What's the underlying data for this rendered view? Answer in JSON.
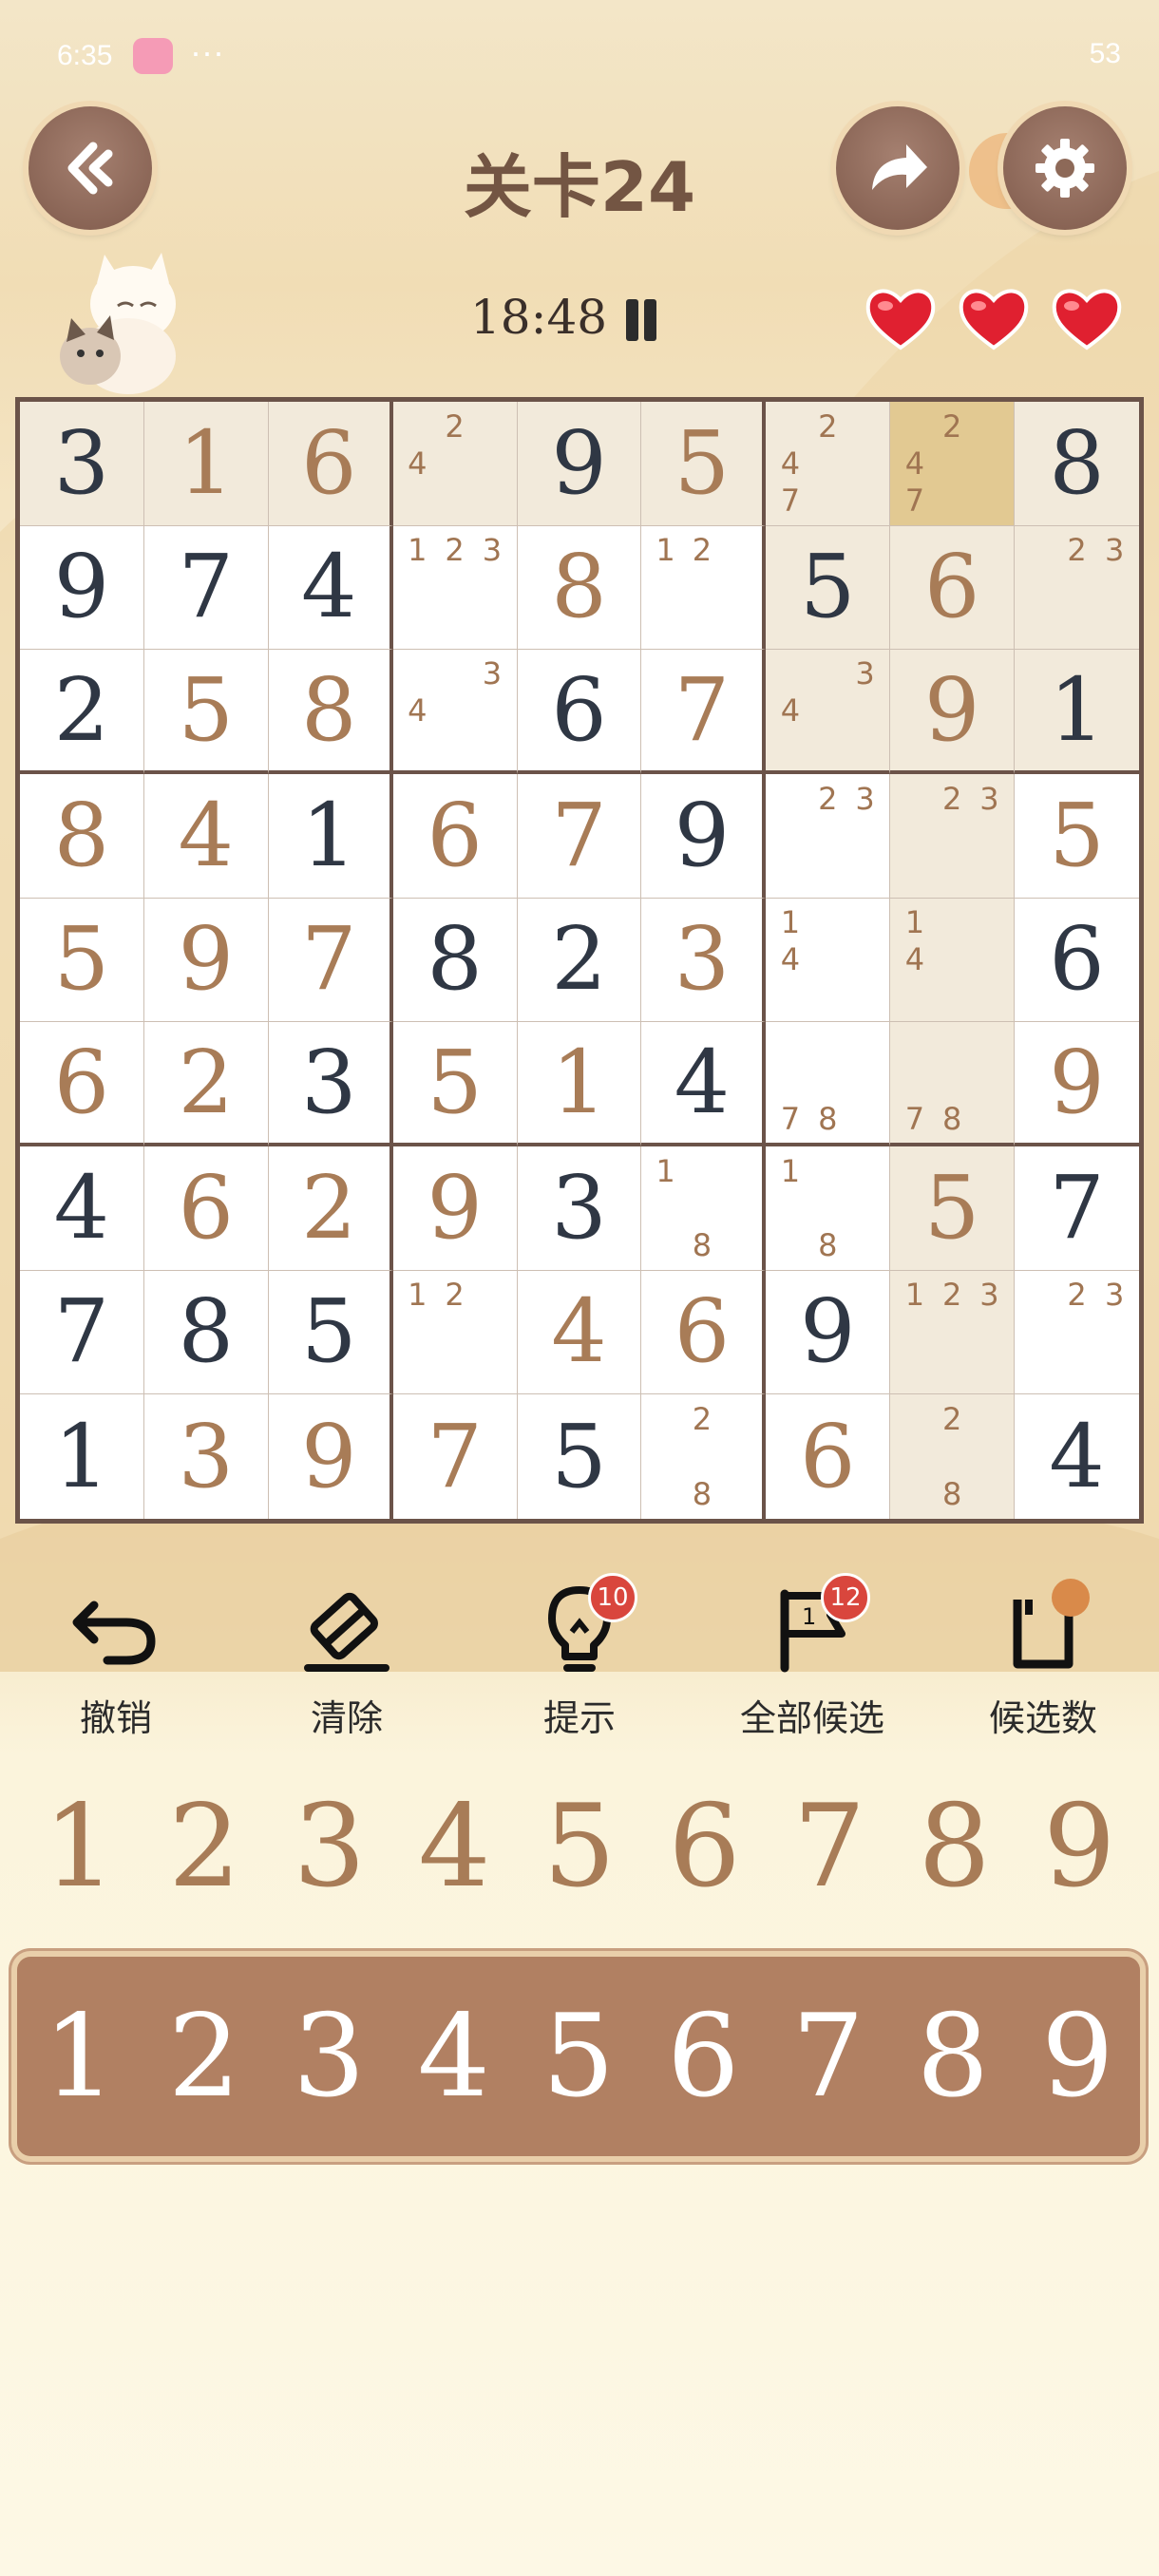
{
  "status_bar": {
    "time": "6:35",
    "dots": "···",
    "right": "53"
  },
  "header": {
    "title": "关卡24",
    "timer": "18:48"
  },
  "board": {
    "cells": [
      [
        {
          "v": "3",
          "t": "given",
          "hl": true
        },
        {
          "v": "1",
          "t": "user",
          "hl": true
        },
        {
          "v": "6",
          "t": "user",
          "hl": true
        },
        {
          "n": [
            "",
            "2",
            "",
            "4",
            "",
            "",
            "",
            "",
            ""
          ],
          "hl": true
        },
        {
          "v": "9",
          "t": "given",
          "hl": true
        },
        {
          "v": "5",
          "t": "user",
          "hl": true
        },
        {
          "n": [
            "",
            "2",
            "",
            "4",
            "",
            "",
            "7",
            "",
            ""
          ],
          "hl": true
        },
        {
          "n": [
            "",
            "2",
            "",
            "4",
            "",
            "",
            "7",
            "",
            ""
          ],
          "sel": true
        },
        {
          "v": "8",
          "t": "given",
          "hl": true
        }
      ],
      [
        {
          "v": "9",
          "t": "given"
        },
        {
          "v": "7",
          "t": "given"
        },
        {
          "v": "4",
          "t": "given"
        },
        {
          "n": [
            "1",
            "2",
            "3",
            "",
            "",
            "",
            "",
            "",
            ""
          ]
        },
        {
          "v": "8",
          "t": "user"
        },
        {
          "n": [
            "1",
            "2",
            "",
            "",
            "",
            "",
            "",
            "",
            ""
          ]
        },
        {
          "v": "5",
          "t": "given",
          "hl": true
        },
        {
          "v": "6",
          "t": "user",
          "hl": true
        },
        {
          "n": [
            "",
            "2",
            "3",
            "",
            "",
            "",
            "",
            "",
            ""
          ],
          "hl": true
        }
      ],
      [
        {
          "v": "2",
          "t": "given"
        },
        {
          "v": "5",
          "t": "user"
        },
        {
          "v": "8",
          "t": "user"
        },
        {
          "n": [
            "",
            "",
            "3",
            "4",
            "",
            "",
            "",
            "",
            ""
          ]
        },
        {
          "v": "6",
          "t": "given"
        },
        {
          "v": "7",
          "t": "user"
        },
        {
          "n": [
            "",
            "",
            "3",
            "4",
            "",
            "",
            "",
            "",
            ""
          ],
          "hl": true
        },
        {
          "v": "9",
          "t": "user",
          "hl": true
        },
        {
          "v": "1",
          "t": "given",
          "hl": true
        }
      ],
      [
        {
          "v": "8",
          "t": "user"
        },
        {
          "v": "4",
          "t": "user"
        },
        {
          "v": "1",
          "t": "given"
        },
        {
          "v": "6",
          "t": "user"
        },
        {
          "v": "7",
          "t": "user"
        },
        {
          "v": "9",
          "t": "given"
        },
        {
          "n": [
            "",
            "2",
            "3",
            "",
            "",
            "",
            "",
            "",
            ""
          ]
        },
        {
          "n": [
            "",
            "2",
            "3",
            "",
            "",
            "",
            "",
            "",
            ""
          ],
          "hl": true
        },
        {
          "v": "5",
          "t": "user"
        }
      ],
      [
        {
          "v": "5",
          "t": "user"
        },
        {
          "v": "9",
          "t": "user"
        },
        {
          "v": "7",
          "t": "user"
        },
        {
          "v": "8",
          "t": "given"
        },
        {
          "v": "2",
          "t": "given"
        },
        {
          "v": "3",
          "t": "user"
        },
        {
          "n": [
            "1",
            "",
            "",
            "4",
            "",
            "",
            "",
            "",
            ""
          ]
        },
        {
          "n": [
            "1",
            "",
            "",
            "4",
            "",
            "",
            "",
            "",
            ""
          ],
          "hl": true
        },
        {
          "v": "6",
          "t": "given"
        }
      ],
      [
        {
          "v": "6",
          "t": "user"
        },
        {
          "v": "2",
          "t": "user"
        },
        {
          "v": "3",
          "t": "given"
        },
        {
          "v": "5",
          "t": "user"
        },
        {
          "v": "1",
          "t": "user"
        },
        {
          "v": "4",
          "t": "given"
        },
        {
          "n": [
            "",
            "",
            "",
            "",
            "",
            "",
            "7",
            "8",
            ""
          ]
        },
        {
          "n": [
            "",
            "",
            "",
            "",
            "",
            "",
            "7",
            "8",
            ""
          ],
          "hl": true
        },
        {
          "v": "9",
          "t": "user"
        }
      ],
      [
        {
          "v": "4",
          "t": "given"
        },
        {
          "v": "6",
          "t": "user"
        },
        {
          "v": "2",
          "t": "user"
        },
        {
          "v": "9",
          "t": "user"
        },
        {
          "v": "3",
          "t": "given"
        },
        {
          "n": [
            "1",
            "",
            "",
            "",
            "",
            "",
            "",
            "8",
            ""
          ]
        },
        {
          "n": [
            "1",
            "",
            "",
            "",
            "",
            "",
            "",
            "8",
            ""
          ]
        },
        {
          "v": "5",
          "t": "user",
          "hl": true
        },
        {
          "v": "7",
          "t": "given"
        }
      ],
      [
        {
          "v": "7",
          "t": "given"
        },
        {
          "v": "8",
          "t": "given"
        },
        {
          "v": "5",
          "t": "given"
        },
        {
          "n": [
            "1",
            "2",
            "",
            "",
            "",
            "",
            "",
            "",
            ""
          ]
        },
        {
          "v": "4",
          "t": "user"
        },
        {
          "v": "6",
          "t": "user"
        },
        {
          "v": "9",
          "t": "given"
        },
        {
          "n": [
            "1",
            "2",
            "3",
            "",
            "",
            "",
            "",
            "",
            ""
          ],
          "hl": true
        },
        {
          "n": [
            "",
            "2",
            "3",
            "",
            "",
            "",
            "",
            "",
            ""
          ]
        }
      ],
      [
        {
          "v": "1",
          "t": "given"
        },
        {
          "v": "3",
          "t": "user"
        },
        {
          "v": "9",
          "t": "user"
        },
        {
          "v": "7",
          "t": "user"
        },
        {
          "v": "5",
          "t": "given"
        },
        {
          "n": [
            "",
            "2",
            "",
            "",
            "",
            "",
            "",
            "8",
            ""
          ]
        },
        {
          "v": "6",
          "t": "user"
        },
        {
          "n": [
            "",
            "2",
            "",
            "",
            "",
            "",
            "",
            "8",
            ""
          ],
          "hl": true
        },
        {
          "v": "4",
          "t": "given"
        }
      ]
    ]
  },
  "tools": {
    "undo": "撤销",
    "clear": "清除",
    "hint": "提示",
    "hint_count": "10",
    "all_candidates": "全部候选",
    "all_candidates_count": "12",
    "candidates": "候选数"
  },
  "numbers_plain": [
    "1",
    "2",
    "3",
    "4",
    "5",
    "6",
    "7",
    "8",
    "9"
  ],
  "numbers_bar": [
    "1",
    "2",
    "3",
    "4",
    "5",
    "6",
    "7",
    "8",
    "9"
  ],
  "icons": {
    "back": "back-arrow-icon",
    "share": "share-arrow-icon",
    "settings": "gear-icon",
    "heart": "heart-icon"
  }
}
